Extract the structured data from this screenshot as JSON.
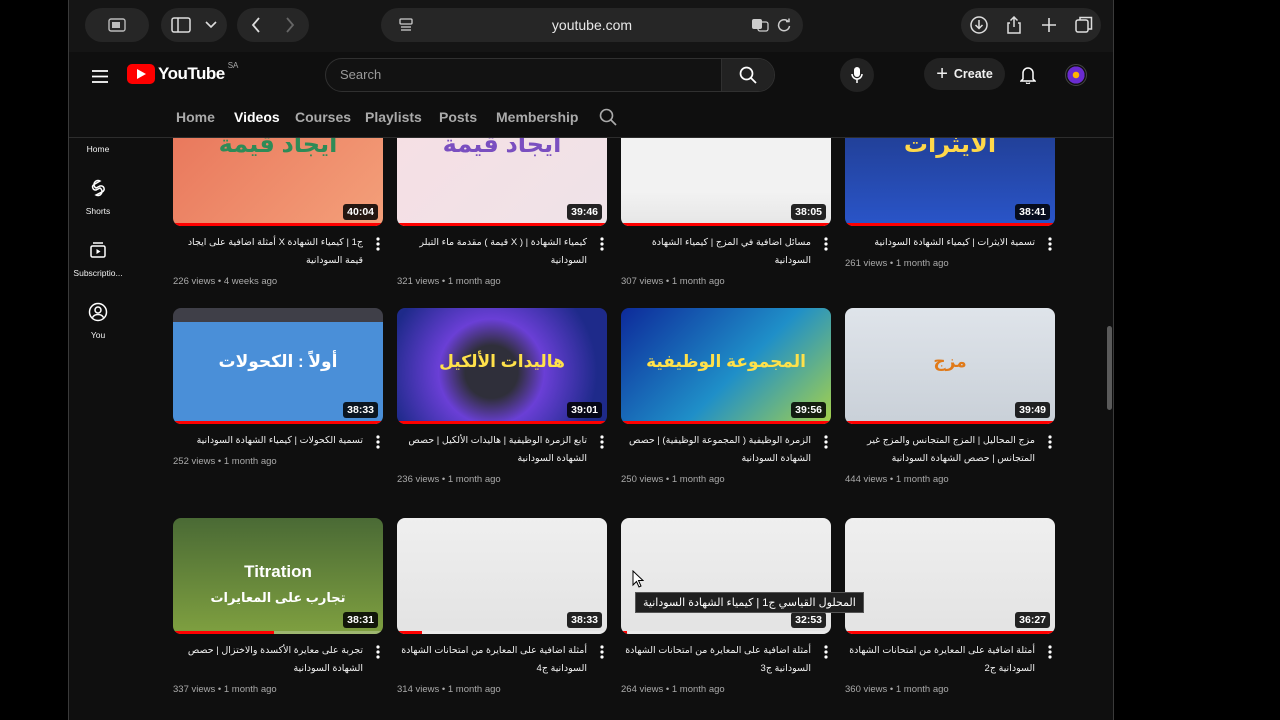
{
  "browser": {
    "url": "youtube.com"
  },
  "header": {
    "logo_text": "YouTube",
    "country_code": "SA",
    "search_placeholder": "Search",
    "create_label": "Create"
  },
  "sidebar": {
    "items": [
      {
        "label": "Home",
        "icon": "home-icon"
      },
      {
        "label": "Shorts",
        "icon": "shorts-icon"
      },
      {
        "label": "Subscriptio...",
        "icon": "subscriptions-icon"
      },
      {
        "label": "You",
        "icon": "user-icon"
      }
    ]
  },
  "tabs": [
    "Home",
    "Videos",
    "Courses",
    "Playlists",
    "Posts",
    "Membership"
  ],
  "active_tab": "Videos",
  "tooltip": "المحلول القياسي ج1 | كيمياء الشهادة السودانية",
  "videos": [
    {
      "title": "ج1 | كيمياء الشهادة X أمثلة اضافية على ايجاد قيمة السودانية",
      "views": "226 views",
      "age": "4 weeks ago",
      "duration": "40:04",
      "thumb_text": "ايجاد قيمة",
      "progress": 1.0
    },
    {
      "title": "كيمياء الشهادة | ( X قيمة ) مقدمة ماء التبلر السودانية",
      "views": "321 views",
      "age": "1 month ago",
      "duration": "39:46",
      "thumb_text": "ايجاد قيمة",
      "progress": 1.0
    },
    {
      "title": "مسائل اضافية في المزج | كيمياء الشهادة السودانية",
      "views": "307 views",
      "age": "1 month ago",
      "duration": "38:05",
      "thumb_text": "",
      "progress": 1.0
    },
    {
      "title": "تسمية الايثرات | كيمياء الشهادة السودانية",
      "views": "261 views",
      "age": "1 month ago",
      "duration": "38:41",
      "thumb_text": "الايثرات",
      "progress": 1.0
    },
    {
      "title": "تسمية الكحولات | كيمياء الشهادة السودانية",
      "views": "252 views",
      "age": "1 month ago",
      "duration": "38:33",
      "thumb_text": "أولاً : الكحولات",
      "progress": 1.0
    },
    {
      "title": "تابع الزمرة الوظيفية | هاليدات الألكيل | حصص الشهادة السودانية",
      "views": "236 views",
      "age": "1 month ago",
      "duration": "39:01",
      "thumb_text": "هاليدات الألكيل",
      "progress": 1.0
    },
    {
      "title": "الزمرة الوظيفية ( المجموعة الوظيفية) | حصص الشهادة السودانية",
      "views": "250 views",
      "age": "1 month ago",
      "duration": "39:56",
      "thumb_text": "المجموعة الوظيفية",
      "progress": 1.0
    },
    {
      "title": "مزج المحاليل | المزج المتجانس والمزج غير المتجانس | حصص الشهادة السودانية",
      "views": "444 views",
      "age": "1 month ago",
      "duration": "39:49",
      "thumb_text": "مزج",
      "progress": 1.0
    },
    {
      "title": "تجربة على معايرة الأكسدة والاختزال | حصص الشهادة السودانية",
      "views": "337 views",
      "age": "1 month ago",
      "duration": "38:31",
      "thumb_text": "Titration",
      "thumb_text2": "تجارب على المعايرات",
      "progress": 0.48
    },
    {
      "title": "أمثلة اضافية على المعايرة من امتحانات الشهادة السودانية ج4",
      "views": "314 views",
      "age": "1 month ago",
      "duration": "38:33",
      "thumb_text": "",
      "progress": 0.12
    },
    {
      "title": "أمثلة اضافية على المعايرة من امتحانات الشهادة السودانية ج3",
      "views": "264 views",
      "age": "1 month ago",
      "duration": "32:53",
      "thumb_text": "",
      "progress": 0.03
    },
    {
      "title": "أمثلة اضافية على المعايرة من امتحانات الشهادة السودانية ج2",
      "views": "360 views",
      "age": "1 month ago",
      "duration": "36:27",
      "thumb_text": "",
      "progress": 1.0
    }
  ]
}
